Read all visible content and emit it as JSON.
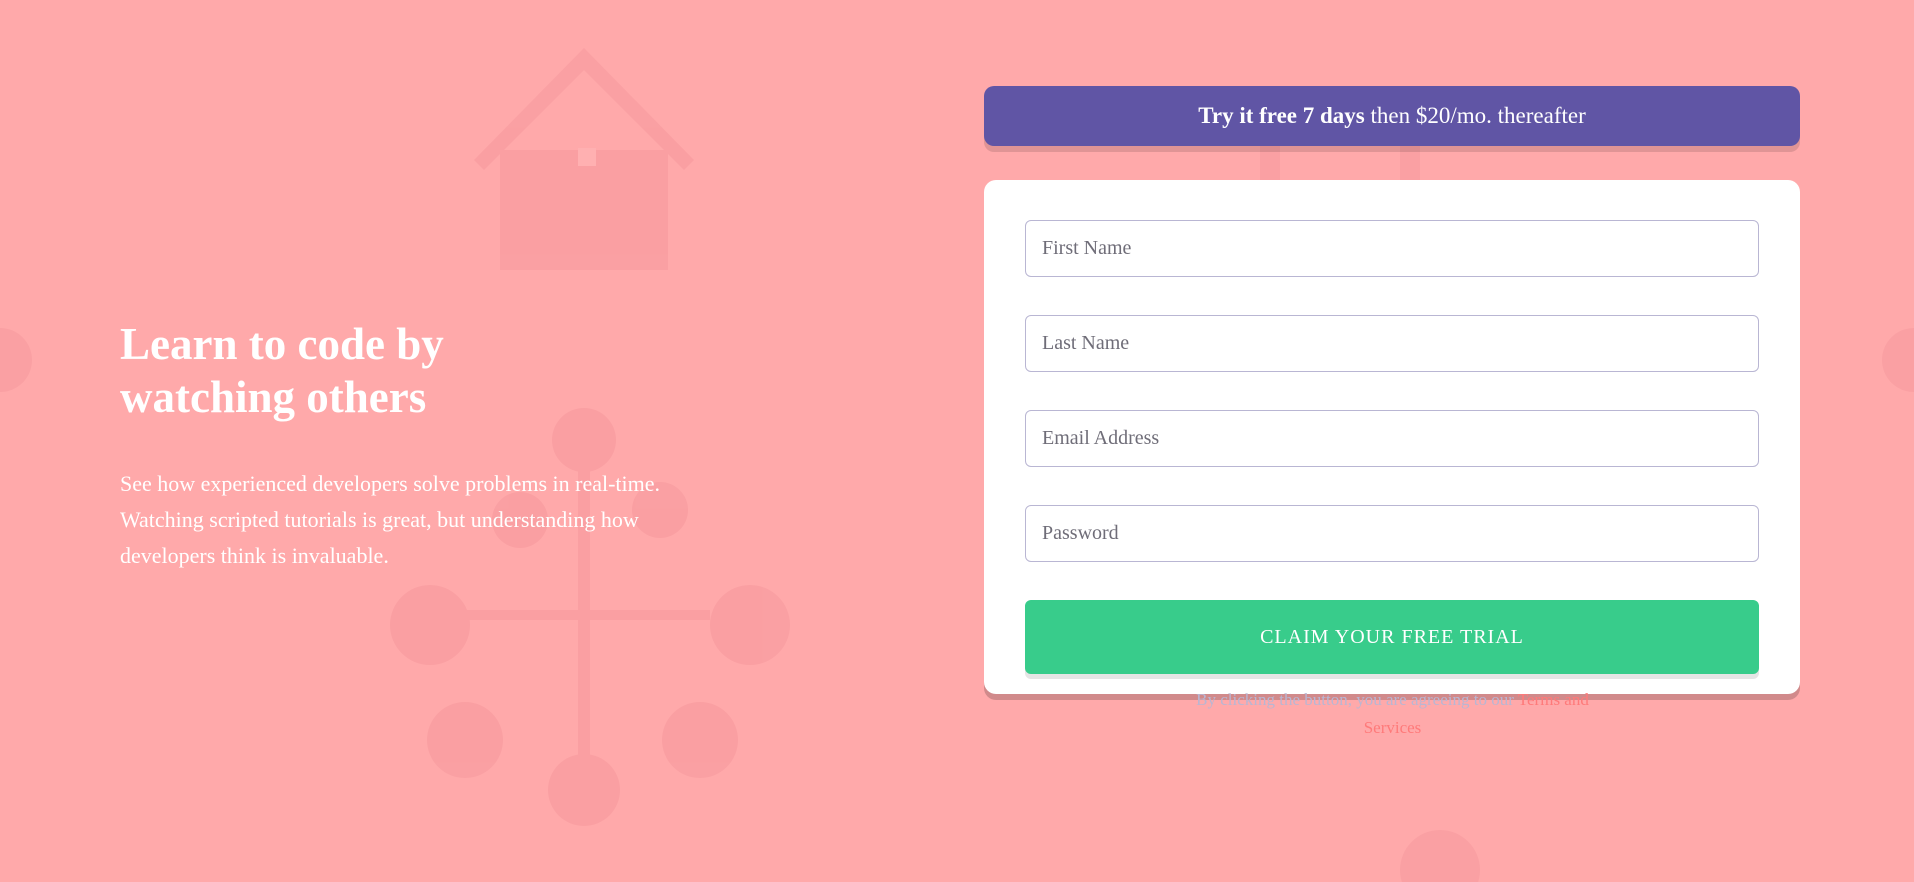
{
  "hero": {
    "headline": "Learn to code by\n watching others",
    "description": "See how experienced developers solve problems in real-time. Watching scripted tutorials is great, but understanding how developers think is invaluable."
  },
  "offer": {
    "bold": "Try it free 7 days",
    "rest": " then $20/mo. thereafter"
  },
  "form": {
    "first_name_placeholder": "First Name",
    "last_name_placeholder": "Last Name",
    "email_placeholder": "Email Address",
    "password_placeholder": "Password",
    "submit_label": "Claim your free trial",
    "legal_text": "By clicking the button, you are agreeing to our ",
    "legal_link": "Terms and Services"
  },
  "colors": {
    "background": "#ffa9aa",
    "banner": "#6055a5",
    "button": "#38cc8b",
    "link": "#ff7a7a"
  },
  "icons": {
    "background": "house-and-tree-diagram-pattern"
  }
}
